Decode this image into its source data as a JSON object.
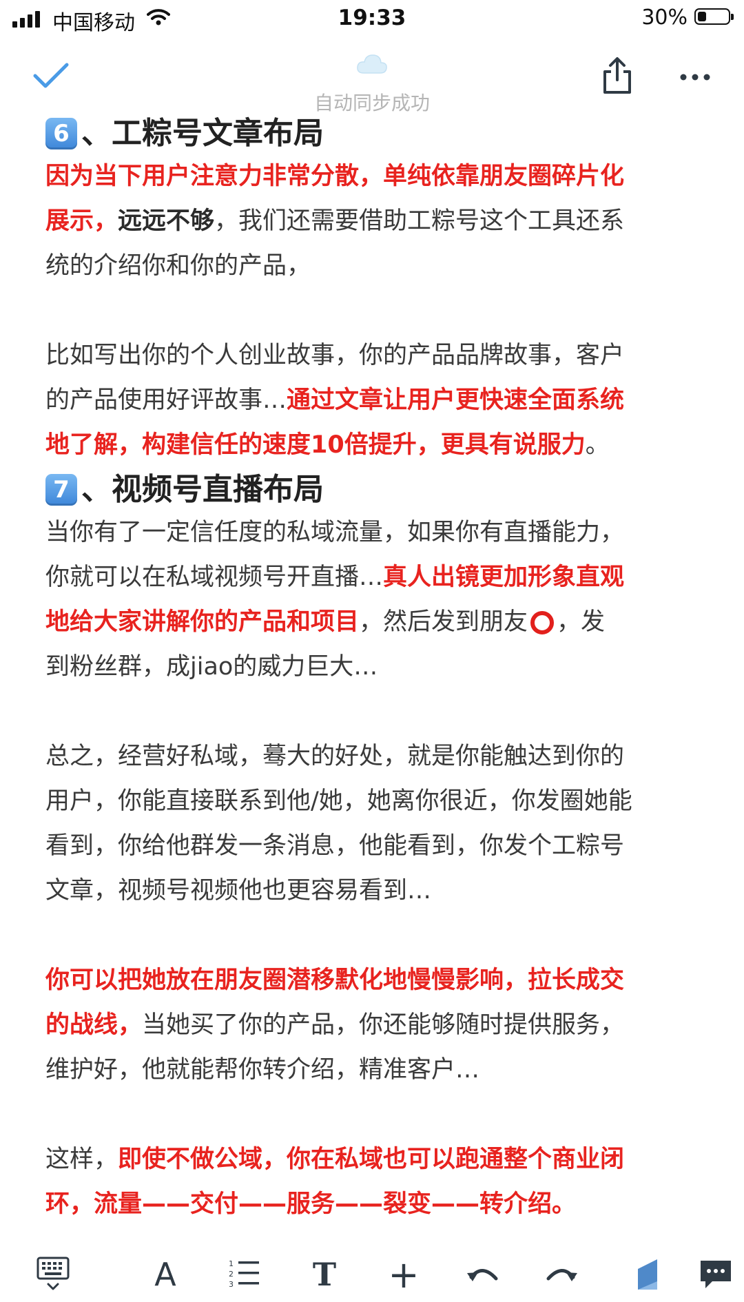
{
  "status_bar": {
    "carrier": "中国移动",
    "time": "19:33",
    "battery": "30%"
  },
  "toolbar": {
    "sync_status": "自动同步成功"
  },
  "article": {
    "section6": {
      "number": "6",
      "title": "、工粽号文章布局",
      "p1_red": "因为当下用户注意力非常分散，单纯依靠朋友圈碎片化",
      "p1_red2": "展示，",
      "p1_bold": "远远不够",
      "p1_rest": "，我们还需要借助工粽号这个工具还系",
      "p1_line3": "统的介绍你和你的产品，",
      "p2_line1": "比如写出你的个人创业故事，你的产品品牌故事，客户",
      "p2_line2_plain": "的产品使用好评故事…",
      "p2_line2_red": "通过文章让用户更快速全面系统",
      "p2_line3_red": "地了解，构建信任的速度10倍提升，更具有说服力",
      "p2_line3_end": "。"
    },
    "section7": {
      "number": "7",
      "title": "、视频号直播布局",
      "p1_line1": "当你有了一定信任度的私域流量，如果你有直播能力，",
      "p1_line2_plain": "你就可以在私域视频号开直播…",
      "p1_line2_red": "真人出镜更加形象直观",
      "p1_line3_red": "地给大家讲解你的产品和项目",
      "p1_line3_plain": "，然后发到朋友",
      "p1_line3_end": "，发",
      "p1_line4": "到粉丝群，成jiao的威力巨大…"
    },
    "summary": {
      "line1": "总之，经营好私域，蓦大的好处，就是你能触达到你的",
      "line2": "用户，你能直接联系到他/她，她离你很近，你发圈她能",
      "line3": "看到，你给他群发一条消息，他能看到，你发个工粽号",
      "line4": "文章，视频号视频他也更容易看到…"
    },
    "moments": {
      "line1_red": "你可以把她放在朋友圈潜移默化地慢慢影响，拉长成交",
      "line2_red": "的战线，",
      "line2_plain": "当她买了你的产品，你还能够随时提供服务，",
      "line3": "维护好，他就能帮你转介绍，精准客户…"
    },
    "conclusion": {
      "line1_plain": "这样，",
      "line1_red": "即使不做公域，你在私域也可以跑通整个商业闭",
      "line2_red": "环，流量——交付——服务——裂变——转介绍。"
    }
  },
  "bottom_toolbar": {
    "font_style": "A",
    "text_style": "T",
    "insert": "+"
  },
  "colors": {
    "highlight_red": "#e8231f",
    "accent_blue": "#4a9be6",
    "keycap_blue": "#3d86d9"
  }
}
